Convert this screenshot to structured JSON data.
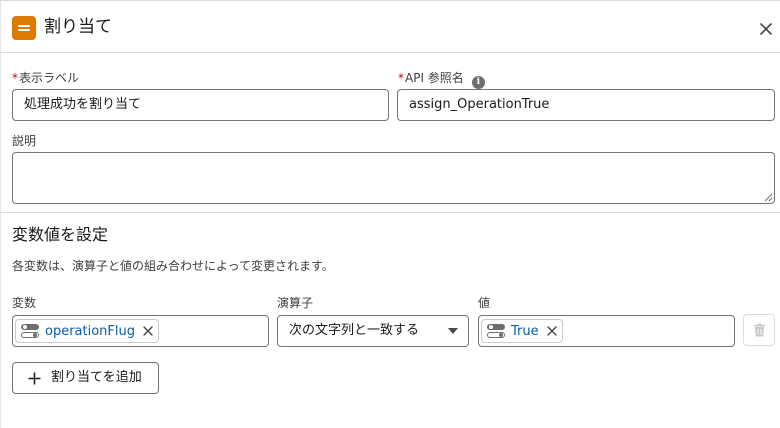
{
  "header": {
    "title": "割り当て",
    "icon": "assignment-icon",
    "icon_color": "#dd7a01"
  },
  "form": {
    "label_field": {
      "required_marker": "*",
      "label": "表示ラベル",
      "value": "処理成功を割り当て"
    },
    "api_field": {
      "required_marker": "*",
      "label": "API 参照名",
      "info_icon": "i",
      "value": "assign_OperationTrue"
    },
    "description_field": {
      "label": "説明",
      "value": ""
    }
  },
  "section": {
    "title": "変数値を設定",
    "description": "各変数は、演算子と値の組み合わせによって変更されます。"
  },
  "assignment_row": {
    "variable_header": "変数",
    "operator_header": "演算子",
    "value_header": "値",
    "variable_pill": "operationFlug",
    "operator_value": "次の文字列と一致する",
    "value_pill": "True"
  },
  "add_button": {
    "label": "割り当てを追加"
  },
  "colors": {
    "pill_text": "#0b5cab",
    "required": "#ba0517",
    "border": "#747474"
  }
}
